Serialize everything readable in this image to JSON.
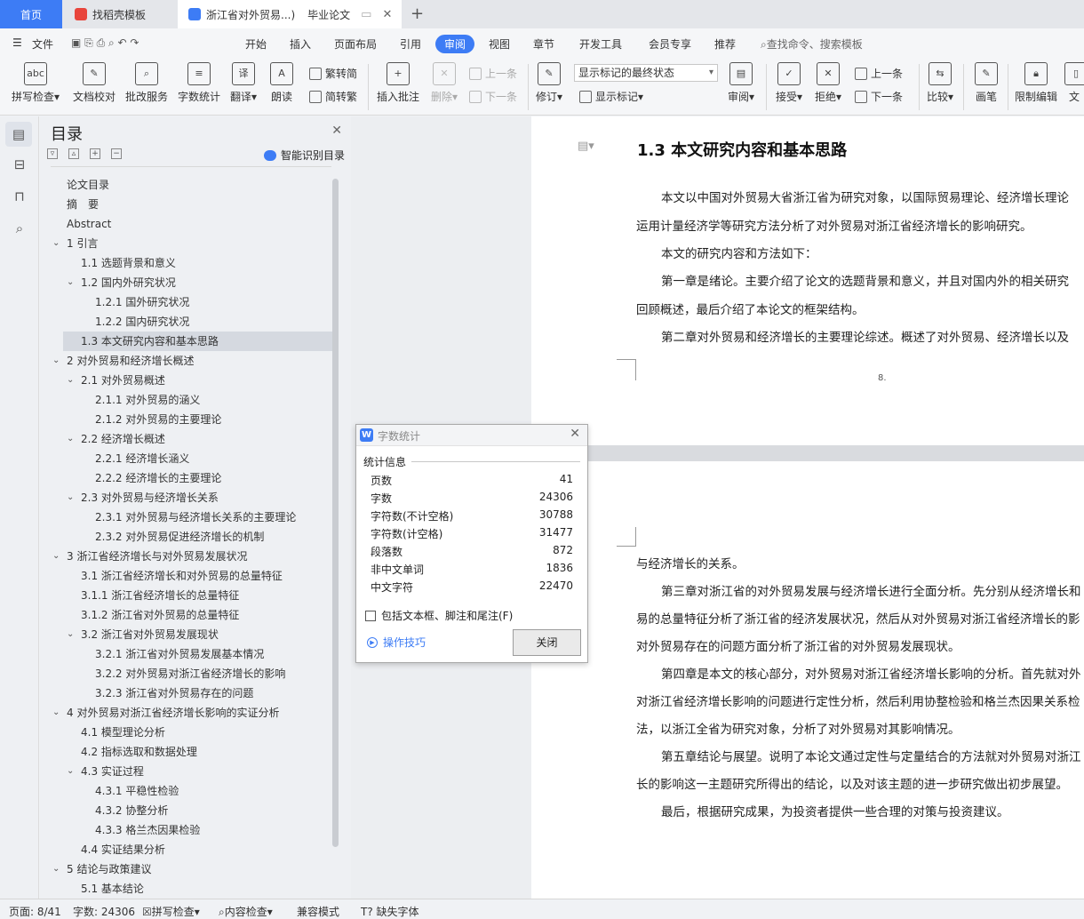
{
  "tabs": {
    "home": "首页",
    "template": "找稻壳模板",
    "doc": "浙江省对外贸易...)",
    "doc_extra": "毕业论文"
  },
  "menu": [
    "文件",
    "开始",
    "插入",
    "页面布局",
    "引用",
    "审阅",
    "视图",
    "章节",
    "开发工具",
    "会员专享",
    "推荐"
  ],
  "menu_active": "审阅",
  "search_placeholder": "查找命令、搜索模板",
  "ribbon": {
    "spell": "拼写检查",
    "proof": "文档校对",
    "batch": "批改服务",
    "wordcount": "字数统计",
    "translate": "翻译",
    "read": "朗读",
    "trad": "繁转简",
    "simp": "简转繁",
    "insert_comment": "插入批注",
    "delete": "删除",
    "prev": "上一条",
    "next": "下一条",
    "revise": "修订",
    "markup_state": "显示标记的最终状态",
    "show_markup": "显示标记",
    "review": "审阅",
    "accept": "接受",
    "reject": "拒绝",
    "prev2": "上一条",
    "next2": "下一条",
    "compare": "比较",
    "pen": "画笔",
    "restrict": "限制编辑",
    "more": "文"
  },
  "toc": {
    "title": "目录",
    "smart": "智能识别目录",
    "items": [
      {
        "text": "论文目录",
        "level": 0
      },
      {
        "text": "摘　要",
        "level": 0
      },
      {
        "text": "Abstract",
        "level": 0
      },
      {
        "text": "1  引言",
        "level": 0,
        "caret": true
      },
      {
        "text": "1.1  选题背景和意义",
        "level": 1
      },
      {
        "text": "1.2  国内外研究状况",
        "level": 1,
        "caret": true
      },
      {
        "text": "1.2.1    国外研究状况",
        "level": 2
      },
      {
        "text": "1.2.2    国内研究状况",
        "level": 2
      },
      {
        "text": "1.3  本文研究内容和基本思路",
        "level": 1,
        "selected": true
      },
      {
        "text": "2  对外贸易和经济增长概述",
        "level": 0,
        "caret": true
      },
      {
        "text": "2.1  对外贸易概述",
        "level": 1,
        "caret": true
      },
      {
        "text": "2.1.1    对外贸易的涵义",
        "level": 2
      },
      {
        "text": "2.1.2 对外贸易的主要理论",
        "level": 2
      },
      {
        "text": "2.2 经济增长概述",
        "level": 1,
        "caret": true
      },
      {
        "text": "2.2.1 经济增长涵义",
        "level": 2
      },
      {
        "text": "2.2.2 经济增长的主要理论",
        "level": 2
      },
      {
        "text": "2.3 对外贸易与经济增长关系",
        "level": 1,
        "caret": true
      },
      {
        "text": "2.3.1 对外贸易与经济增长关系的主要理论",
        "level": 2
      },
      {
        "text": "2.3.2 对外贸易促进经济增长的机制",
        "level": 2
      },
      {
        "text": "3  浙江省经济增长与对外贸易发展状况",
        "level": 0,
        "caret": true
      },
      {
        "text": "3.1  浙江省经济增长和对外贸易的总量特征",
        "level": 1
      },
      {
        "text": "3.1.1 浙江省经济增长的总量特征",
        "level": 1
      },
      {
        "text": "3.1.2 浙江省对外贸易的总量特征",
        "level": 1
      },
      {
        "text": "3.2  浙江省对外贸易发展现状",
        "level": 1,
        "caret": true
      },
      {
        "text": "3.2.1 浙江省对外贸易发展基本情况",
        "level": 2
      },
      {
        "text": "3.2.2 对外贸易对浙江省经济增长的影响",
        "level": 2
      },
      {
        "text": "3.2.3 浙江省对外贸易存在的问题",
        "level": 2
      },
      {
        "text": "4  对外贸易对浙江省经济增长影响的实证分析",
        "level": 0,
        "caret": true
      },
      {
        "text": "4.1  模型理论分析",
        "level": 1
      },
      {
        "text": "4.2 指标选取和数据处理",
        "level": 1
      },
      {
        "text": "4.3 实证过程",
        "level": 1,
        "caret": true
      },
      {
        "text": "4.3.1 平稳性检验",
        "level": 2
      },
      {
        "text": "4.3.2 协整分析",
        "level": 2
      },
      {
        "text": "4.3.3 格兰杰因果检验",
        "level": 2
      },
      {
        "text": "4.4 实证结果分析",
        "level": 1
      },
      {
        "text": "5  结论与政策建议",
        "level": 0,
        "caret": true
      },
      {
        "text": "5.1 基本结论",
        "level": 1
      }
    ]
  },
  "doc": {
    "heading": "1.3  本文研究内容和基本思路",
    "page1": [
      "本文以中国对外贸易大省浙江省为研究对象，以国际贸易理论、经济增长理论",
      "运用计量经济学等研究方法分析了对外贸易对浙江省经济增长的影响研究。",
      "本文的研究内容和方法如下：",
      "第一章是绪论。主要介绍了论文的选题背景和意义，并且对国内外的相关研究",
      "回顾概述，最后介绍了本论文的框架结构。",
      "第二章对外贸易和经济增长的主要理论综述。概述了对外贸易、经济增长以及"
    ],
    "page_num": "8.",
    "page2": [
      "与经济增长的关系。",
      "第三章对浙江省的对外贸易发展与经济增长进行全面分析。先分别从经济增长和",
      "易的总量特征分析了浙江省的经济发展状况，然后从对外贸易对浙江省经济增长的影",
      "对外贸易存在的问题方面分析了浙江省的对外贸易发展现状。",
      "第四章是本文的核心部分，对外贸易对浙江省经济增长影响的分析。首先就对外",
      "对浙江省经济增长影响的问题进行定性分析，然后利用协整检验和格兰杰因果关系检",
      "法，以浙江全省为研究对象，分析了对外贸易对其影响情况。",
      "第五章结论与展望。说明了本论文通过定性与定量结合的方法就对外贸易对浙江",
      "长的影响这一主题研究所得出的结论，以及对该主题的进一步研究做出初步展望。",
      "最后，根据研究成果，为投资者提供一些合理的对策与投资建议。"
    ]
  },
  "dialog": {
    "title": "字数统计",
    "section": "统计信息",
    "stats": [
      {
        "label": "页数",
        "value": "41"
      },
      {
        "label": "字数",
        "value": "24306"
      },
      {
        "label": "字符数(不计空格)",
        "value": "30788"
      },
      {
        "label": "字符数(计空格)",
        "value": "31477"
      },
      {
        "label": "段落数",
        "value": "872"
      },
      {
        "label": "非中文单词",
        "value": "1836"
      },
      {
        "label": "中文字符",
        "value": "22470"
      }
    ],
    "include": "包括文本框、脚注和尾注(F)",
    "tip": "操作技巧",
    "close": "关闭"
  },
  "status": {
    "page": "页面: 8/41",
    "words": "字数: 24306",
    "spell": "拼写检查",
    "content": "内容检查",
    "compat": "兼容模式",
    "font": "缺失字体"
  },
  "colors": {
    "accent": "#3d7cf5"
  }
}
